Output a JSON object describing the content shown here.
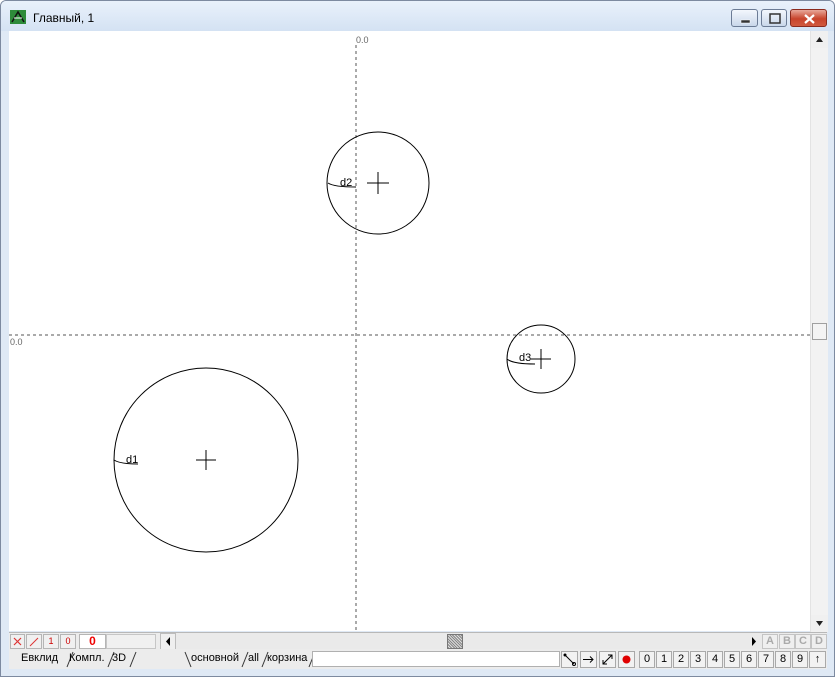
{
  "window": {
    "title": "Главный, 1",
    "accent_color": "#c8442c"
  },
  "canvas": {
    "axis_label_top": "0.0",
    "axis_label_left": "0.0",
    "circles": [
      {
        "id": "d1",
        "label": "d1"
      },
      {
        "id": "d2",
        "label": "d2"
      },
      {
        "id": "d3",
        "label": "d3"
      }
    ]
  },
  "toolbar": {
    "delete_icon": "x-icon",
    "line_icon": "slash-icon",
    "one_label": "1",
    "zero_label": "0",
    "counter_value": "0",
    "letters": [
      "A",
      "B",
      "C",
      "D"
    ]
  },
  "tabs": {
    "left": [
      "Евклид",
      "Компл.",
      "3D"
    ],
    "right": [
      "основной",
      "all",
      "корзина"
    ]
  },
  "tools": {
    "numbers": [
      "0",
      "1",
      "2",
      "3",
      "4",
      "5",
      "6",
      "7",
      "8",
      "9"
    ],
    "up_arrow": "↑",
    "record_color": "#e00000"
  }
}
